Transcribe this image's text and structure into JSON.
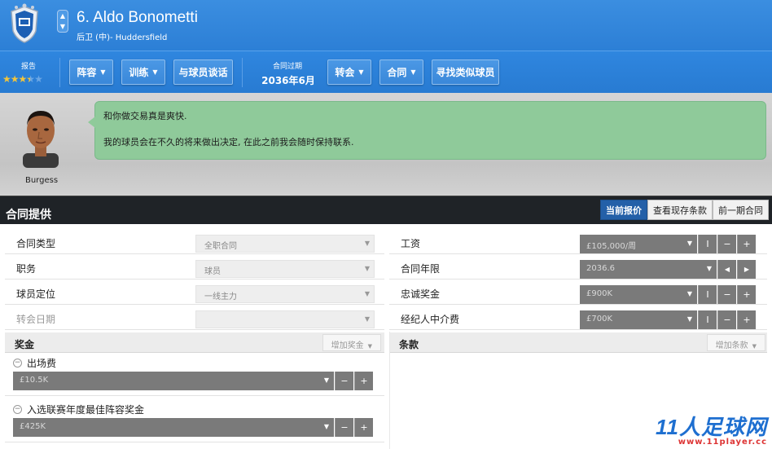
{
  "player": {
    "name": "6. Aldo Bonometti",
    "subtitle": "后卫 (中)- Huddersfield"
  },
  "toolbar": {
    "report_label": "报告",
    "rating_stars": 3.5,
    "rating_max": 5,
    "squad_label": "阵容",
    "training_label": "训练",
    "talk_label": "与球员谈话",
    "contract_expiry_label": "合同过期",
    "contract_expiry_value": "2036年6月",
    "transfer_label": "转会",
    "contract_label": "合同",
    "find_similar_label": "寻找类似球员"
  },
  "message": {
    "agent_name": "Burgess",
    "line1": "和你做交易真是爽快.",
    "line2": "我的球员会在不久的将来做出决定, 在此之前我会随时保持联系."
  },
  "contract": {
    "title": "合同提供",
    "tabs": [
      "当前报价",
      "查看现存条款",
      "前一期合同"
    ],
    "active_tab": 0,
    "left_rows": [
      {
        "label": "合同类型",
        "value": "全职合同"
      },
      {
        "label": "职务",
        "value": "球员"
      },
      {
        "label": "球员定位",
        "value": "一线主力"
      },
      {
        "label": "转会日期",
        "value": ""
      }
    ],
    "right_rows": [
      {
        "label": "工资",
        "value": "£105,000/周"
      },
      {
        "label": "合同年限",
        "value": "2036.6"
      },
      {
        "label": "忠诚奖金",
        "value": "£900K"
      },
      {
        "label": "经纪人中介费",
        "value": "£700K"
      }
    ],
    "bonus": {
      "title": "奖金",
      "add_label": "增加奖金",
      "items": [
        {
          "label": "出场费",
          "value": "£10.5K"
        },
        {
          "label": "入选联赛年度最佳阵容奖金",
          "value": "£425K"
        }
      ]
    },
    "clauses": {
      "title": "条款",
      "add_label": "增加条款"
    }
  },
  "watermark": {
    "brand": "11人足球网",
    "url": "www.11player.cc"
  },
  "icons": {
    "up": "▲",
    "down": "▼",
    "caret": "▼",
    "cursor": "I",
    "minus": "−",
    "plus": "+",
    "left": "◀",
    "right": "▶"
  },
  "colors": {
    "header_blue": "#2f86df",
    "bubble_green": "#8fca9a",
    "section_dark": "#1f2327",
    "active_tab": "#2460a8",
    "star_gold": "#f3c53b"
  }
}
